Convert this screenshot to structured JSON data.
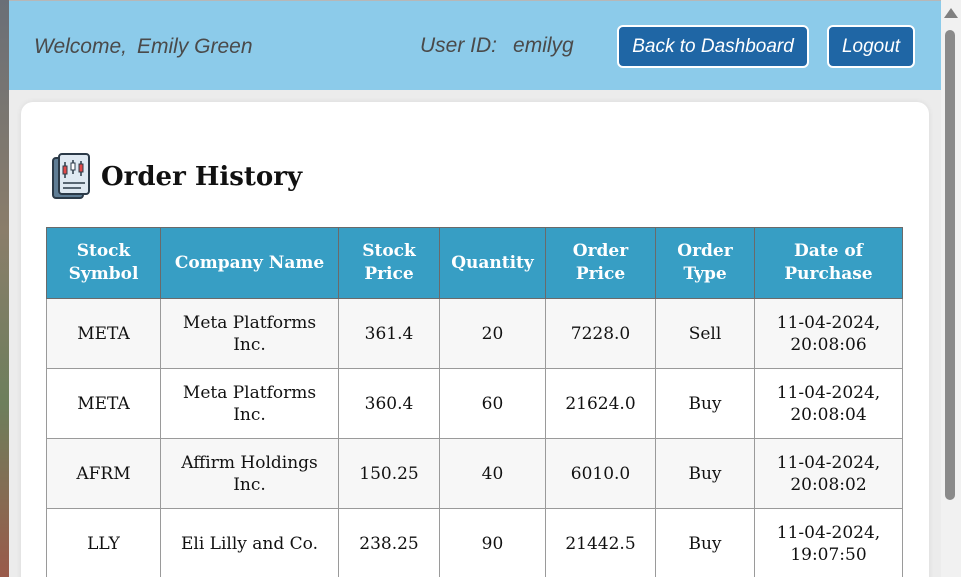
{
  "header": {
    "welcome_label": "Welcome,",
    "user_name": "Emily Green",
    "user_id_label": "User ID:",
    "user_id": "emilyg",
    "dashboard_button": "Back to Dashboard",
    "logout_button": "Logout"
  },
  "page": {
    "title": "Order History",
    "title_icon": "stock-chart-document-icon"
  },
  "table": {
    "columns": [
      [
        "Stock",
        "Symbol"
      ],
      [
        "Company Name"
      ],
      [
        "Stock",
        "Price"
      ],
      [
        "Quantity"
      ],
      [
        "Order",
        "Price"
      ],
      [
        "Order",
        "Type"
      ],
      [
        "Date of",
        "Purchase"
      ]
    ],
    "rows": [
      {
        "symbol": "META",
        "company": [
          "Meta Platforms",
          "Inc."
        ],
        "stock_price": "361.4",
        "quantity": "20",
        "order_price": "7228.0",
        "order_type": "Sell",
        "date": [
          "11-04-2024,",
          "20:08:06"
        ]
      },
      {
        "symbol": "META",
        "company": [
          "Meta Platforms",
          "Inc."
        ],
        "stock_price": "360.4",
        "quantity": "60",
        "order_price": "21624.0",
        "order_type": "Buy",
        "date": [
          "11-04-2024,",
          "20:08:04"
        ]
      },
      {
        "symbol": "AFRM",
        "company": [
          "Affirm Holdings",
          "Inc."
        ],
        "stock_price": "150.25",
        "quantity": "40",
        "order_price": "6010.0",
        "order_type": "Buy",
        "date": [
          "11-04-2024,",
          "20:08:02"
        ]
      },
      {
        "symbol": "LLY",
        "company": [
          "Eli Lilly and Co."
        ],
        "stock_price": "238.25",
        "quantity": "90",
        "order_price": "21442.5",
        "order_type": "Buy",
        "date": [
          "11-04-2024,",
          "19:07:50"
        ]
      }
    ]
  },
  "colors": {
    "header_bg": "#8ccbea",
    "button_bg": "#1f66a5",
    "table_header_bg": "#379ec4"
  }
}
